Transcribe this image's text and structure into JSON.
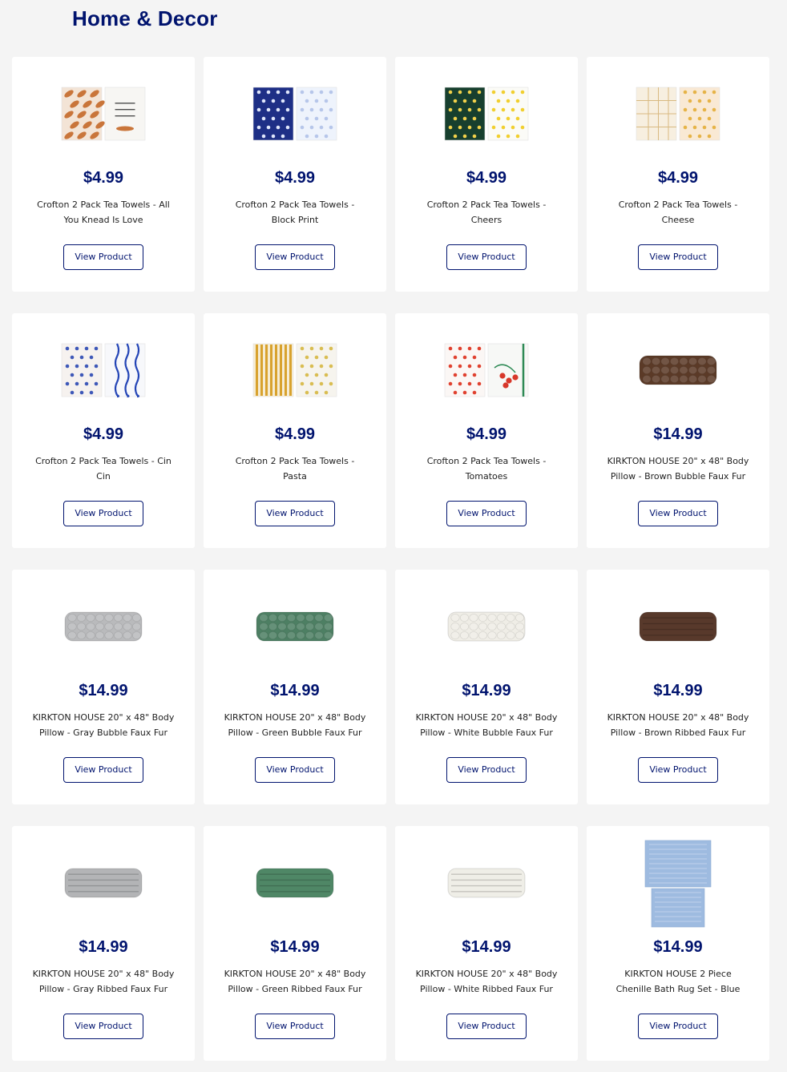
{
  "page": {
    "title": "Home & Decor"
  },
  "colors": {
    "brand_navy": "#00136e",
    "page_background": "#f4f4f4",
    "card_background": "#ffffff"
  },
  "products": [
    {
      "price": "$4.99",
      "name": "Crofton 2 Pack Tea Towels - All You Knead Is Love",
      "button_label": "View Product",
      "image": {
        "kind": "towels",
        "left": {
          "bg": "#f3e4d6",
          "ink": "#c9753a",
          "pattern": "loaves"
        },
        "right": {
          "bg": "#f7f6f3",
          "ink": "#4b4b4b",
          "pattern": "lettering"
        }
      }
    },
    {
      "price": "$4.99",
      "name": "Crofton 2 Pack Tea Towels - Block Print",
      "button_label": "View Product",
      "image": {
        "kind": "towels",
        "left": {
          "bg": "#1e2f86",
          "ink": "#dfe6fb",
          "pattern": "dots"
        },
        "right": {
          "bg": "#eef3fc",
          "ink": "#b6c6ea",
          "pattern": "dots"
        }
      }
    },
    {
      "price": "$4.99",
      "name": "Crofton 2 Pack Tea Towels - Cheers",
      "button_label": "View Product",
      "image": {
        "kind": "towels",
        "left": {
          "bg": "#173f2e",
          "ink": "#f2d14a",
          "pattern": "dots"
        },
        "right": {
          "bg": "#fbfbf7",
          "ink": "#f1cf2f",
          "pattern": "dots"
        }
      }
    },
    {
      "price": "$4.99",
      "name": "Crofton 2 Pack Tea Towels - Cheese",
      "button_label": "View Product",
      "image": {
        "kind": "towels",
        "left": {
          "bg": "#f7efe0",
          "ink": "#d8b981",
          "pattern": "plaid"
        },
        "right": {
          "bg": "#f9e9d4",
          "ink": "#e6b347",
          "pattern": "dots"
        }
      }
    },
    {
      "price": "$4.99",
      "name": "Crofton 2 Pack Tea Towels - Cin Cin",
      "button_label": "View Product",
      "image": {
        "kind": "towels",
        "left": {
          "bg": "#f6f2ef",
          "ink": "#3e58b8",
          "pattern": "dots"
        },
        "right": {
          "bg": "#f7f8fb",
          "ink": "#2445b6",
          "pattern": "waves"
        }
      }
    },
    {
      "price": "$4.99",
      "name": "Crofton 2 Pack Tea Towels - Pasta",
      "button_label": "View Product",
      "image": {
        "kind": "towels",
        "left": {
          "bg": "#f6ecd3",
          "ink": "#d8a22e",
          "pattern": "stripes"
        },
        "right": {
          "bg": "#f6f4ee",
          "ink": "#d9bd52",
          "pattern": "dots"
        }
      }
    },
    {
      "price": "$4.99",
      "name": "Crofton 2 Pack Tea Towels - Tomatoes",
      "button_label": "View Product",
      "image": {
        "kind": "towels",
        "left": {
          "bg": "#fbf7f5",
          "ink": "#e0412f",
          "pattern": "dots"
        },
        "right": {
          "bg": "#f7f8f6",
          "ink": "#2e8a55",
          "pattern": "vine"
        }
      }
    },
    {
      "price": "$14.99",
      "name": "KIRKTON HOUSE 20\" x 48\" Body Pillow - Brown Bubble Faux Fur",
      "button_label": "View Product",
      "image": {
        "kind": "pillow",
        "color": "#5b3a27",
        "texture": "bubble"
      }
    },
    {
      "price": "$14.99",
      "name": "KIRKTON HOUSE 20\" x 48\" Body Pillow - Gray Bubble Faux Fur",
      "button_label": "View Product",
      "image": {
        "kind": "pillow",
        "color": "#b9babc",
        "texture": "bubble"
      }
    },
    {
      "price": "$14.99",
      "name": "KIRKTON HOUSE 20\" x 48\" Body Pillow - Green Bubble Faux Fur",
      "button_label": "View Product",
      "image": {
        "kind": "pillow",
        "color": "#4d7f63",
        "texture": "bubble"
      }
    },
    {
      "price": "$14.99",
      "name": "KIRKTON HOUSE 20\" x 48\" Body Pillow - White Bubble Faux Fur",
      "button_label": "View Product",
      "image": {
        "kind": "pillow",
        "color": "#efede6",
        "texture": "bubble"
      }
    },
    {
      "price": "$14.99",
      "name": "KIRKTON HOUSE 20\" x 48\" Body Pillow - Brown Ribbed Faux Fur",
      "button_label": "View Product",
      "image": {
        "kind": "pillow",
        "color": "#58392b",
        "texture": "ribbed"
      }
    },
    {
      "price": "$14.99",
      "name": "KIRKTON HOUSE 20\" x 48\" Body Pillow - Gray Ribbed Faux Fur",
      "button_label": "View Product",
      "image": {
        "kind": "pillow",
        "color": "#b3b4b6",
        "texture": "ribbed"
      }
    },
    {
      "price": "$14.99",
      "name": "KIRKTON HOUSE 20\" x 48\" Body Pillow - Green Ribbed Faux Fur",
      "button_label": "View Product",
      "image": {
        "kind": "pillow",
        "color": "#4f8766",
        "texture": "ribbed"
      }
    },
    {
      "price": "$14.99",
      "name": "KIRKTON HOUSE 20\" x 48\" Body Pillow - White Ribbed Faux Fur",
      "button_label": "View Product",
      "image": {
        "kind": "pillow",
        "color": "#efeee7",
        "texture": "ribbed"
      }
    },
    {
      "price": "$14.99",
      "name": "KIRKTON HOUSE 2 Piece Chenille Bath Rug Set - Blue",
      "button_label": "View Product",
      "image": {
        "kind": "rugs",
        "color": "#9ebbe0"
      }
    }
  ]
}
